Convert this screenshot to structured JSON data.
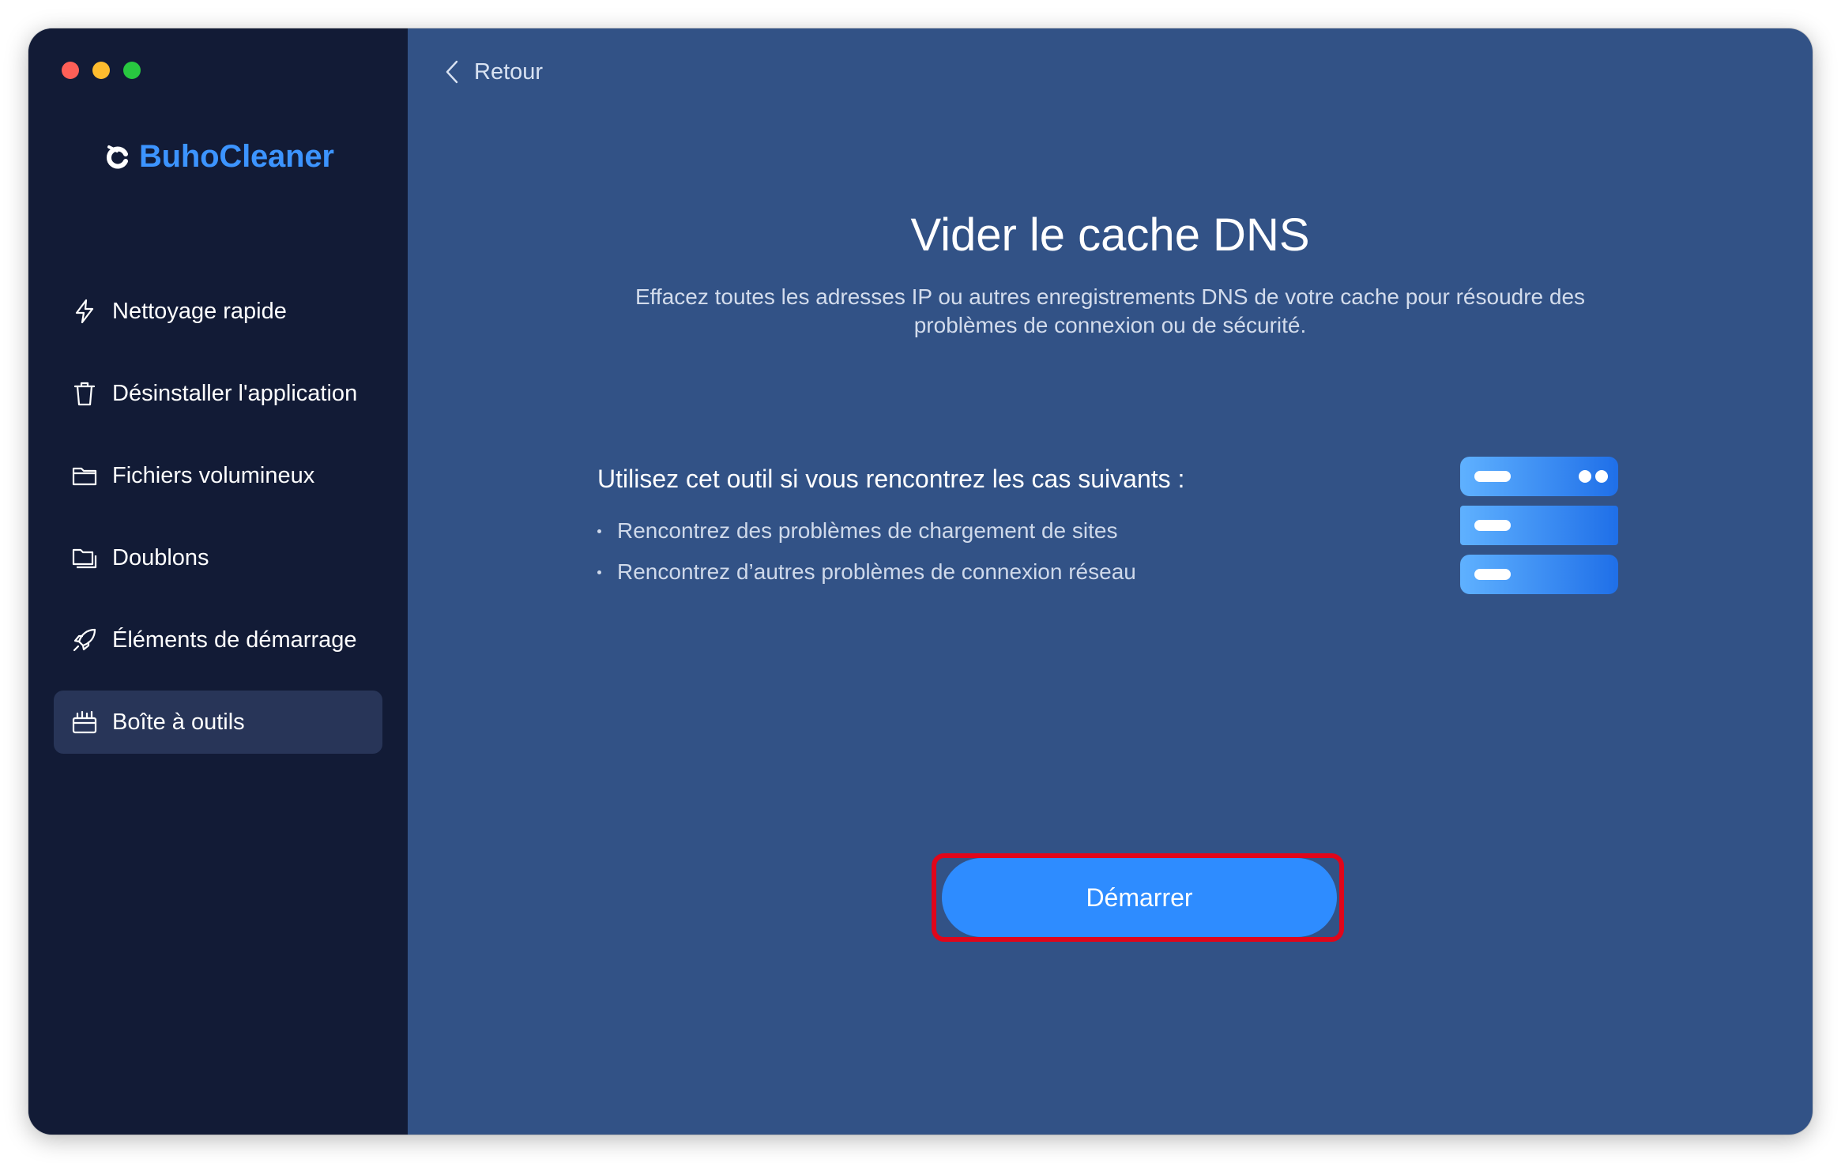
{
  "window": {
    "traffic_lights": [
      "close",
      "minimize",
      "zoom"
    ]
  },
  "sidebar": {
    "brand": {
      "name": "BuhoCleaner",
      "icon": "buhocleaner-logo-icon",
      "color": "#3c94ff"
    },
    "items": [
      {
        "label": "Nettoyage rapide",
        "icon": "lightning-icon",
        "active": false
      },
      {
        "label": "Désinstaller l'application",
        "icon": "trash-icon",
        "active": false
      },
      {
        "label": "Fichiers volumineux",
        "icon": "folder-icon",
        "active": false
      },
      {
        "label": "Doublons",
        "icon": "duplicate-folder-icon",
        "active": false
      },
      {
        "label": "Éléments de démarrage",
        "icon": "rocket-icon",
        "active": false
      },
      {
        "label": "Boîte à outils",
        "icon": "toolbox-icon",
        "active": true
      }
    ]
  },
  "main": {
    "back_label": "Retour",
    "title": "Vider le cache DNS",
    "subtitle": "Effacez toutes les adresses IP ou autres enregistrements DNS de votre cache pour résoudre des problèmes de connexion ou de sécurité.",
    "cases_title": "Utilisez cet outil si vous rencontrez les cas suivants :",
    "cases": [
      "Rencontrez des problèmes de chargement de sites",
      "Rencontrez d’autres problèmes de connexion réseau"
    ],
    "illustration_icon": "dns-server-icon",
    "start_label": "Démarrer",
    "accent_color": "#2e8cff",
    "highlight_color": "#e0061a"
  }
}
